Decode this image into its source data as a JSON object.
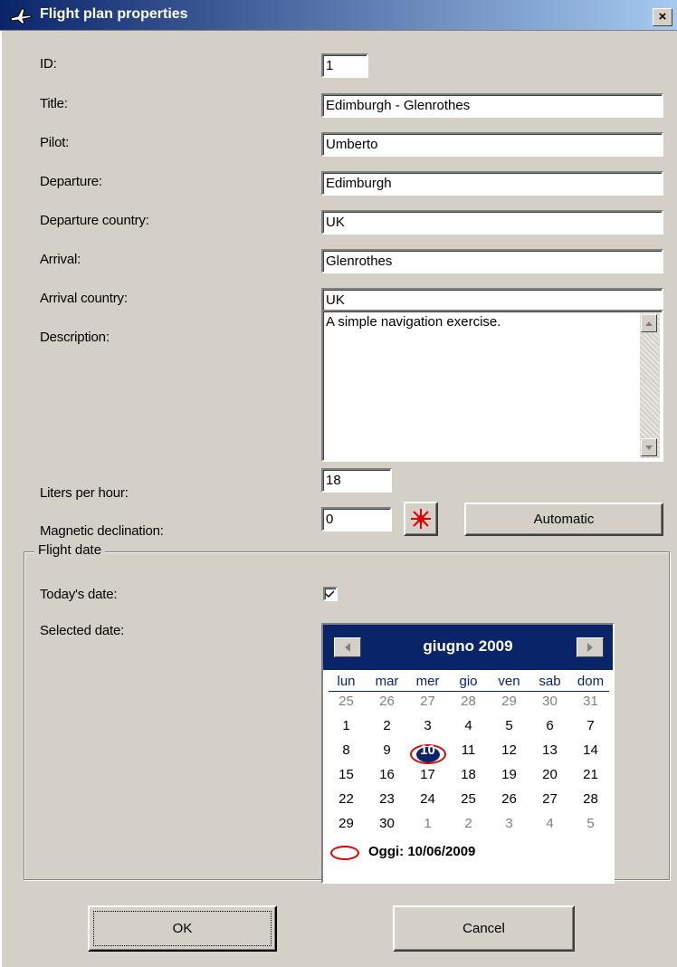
{
  "window": {
    "title": "Flight plan properties",
    "close_label": "×"
  },
  "fields": {
    "id": {
      "label": "ID:",
      "value": "1"
    },
    "title": {
      "label": "Title:",
      "value": "Edimburgh - Glenrothes"
    },
    "pilot": {
      "label": "Pilot:",
      "value": "Umberto"
    },
    "departure": {
      "label": "Departure:",
      "value": "Edimburgh"
    },
    "departure_country": {
      "label": "Departure country:",
      "value": "UK"
    },
    "arrival": {
      "label": "Arrival:",
      "value": "Glenrothes"
    },
    "arrival_country": {
      "label": "Arrival country:",
      "value": "UK"
    },
    "description": {
      "label": "Description:",
      "value": "A simple navigation exercise."
    },
    "liters_per_hour": {
      "label": "Liters per hour:",
      "value": "18"
    },
    "magnetic_declination": {
      "label": "Magnetic declination:",
      "value": "0"
    }
  },
  "automatic_button": "Automatic",
  "flight_date": {
    "group_label": "Flight date",
    "todays_date_label": "Today's date:",
    "todays_date_checked": true,
    "selected_date_label": "Selected date:"
  },
  "calendar": {
    "month_label": "giugno 2009",
    "weekdays": [
      "lun",
      "mar",
      "mer",
      "gio",
      "ven",
      "sab",
      "dom"
    ],
    "weeks": [
      [
        "25",
        "26",
        "27",
        "28",
        "29",
        "30",
        "31"
      ],
      [
        "1",
        "2",
        "3",
        "4",
        "5",
        "6",
        "7"
      ],
      [
        "8",
        "9",
        "10",
        "11",
        "12",
        "13",
        "14"
      ],
      [
        "15",
        "16",
        "17",
        "18",
        "19",
        "20",
        "21"
      ],
      [
        "22",
        "23",
        "24",
        "25",
        "26",
        "27",
        "28"
      ],
      [
        "29",
        "30",
        "1",
        "2",
        "3",
        "4",
        "5"
      ]
    ],
    "selected_day": "10",
    "today_label": "Oggi: 10/06/2009"
  },
  "buttons": {
    "ok": "OK",
    "cancel": "Cancel"
  },
  "colors": {
    "titlebar": "#0a246a",
    "dialog_bg": "#d4d0c8",
    "highlight_red": "#e00000"
  }
}
